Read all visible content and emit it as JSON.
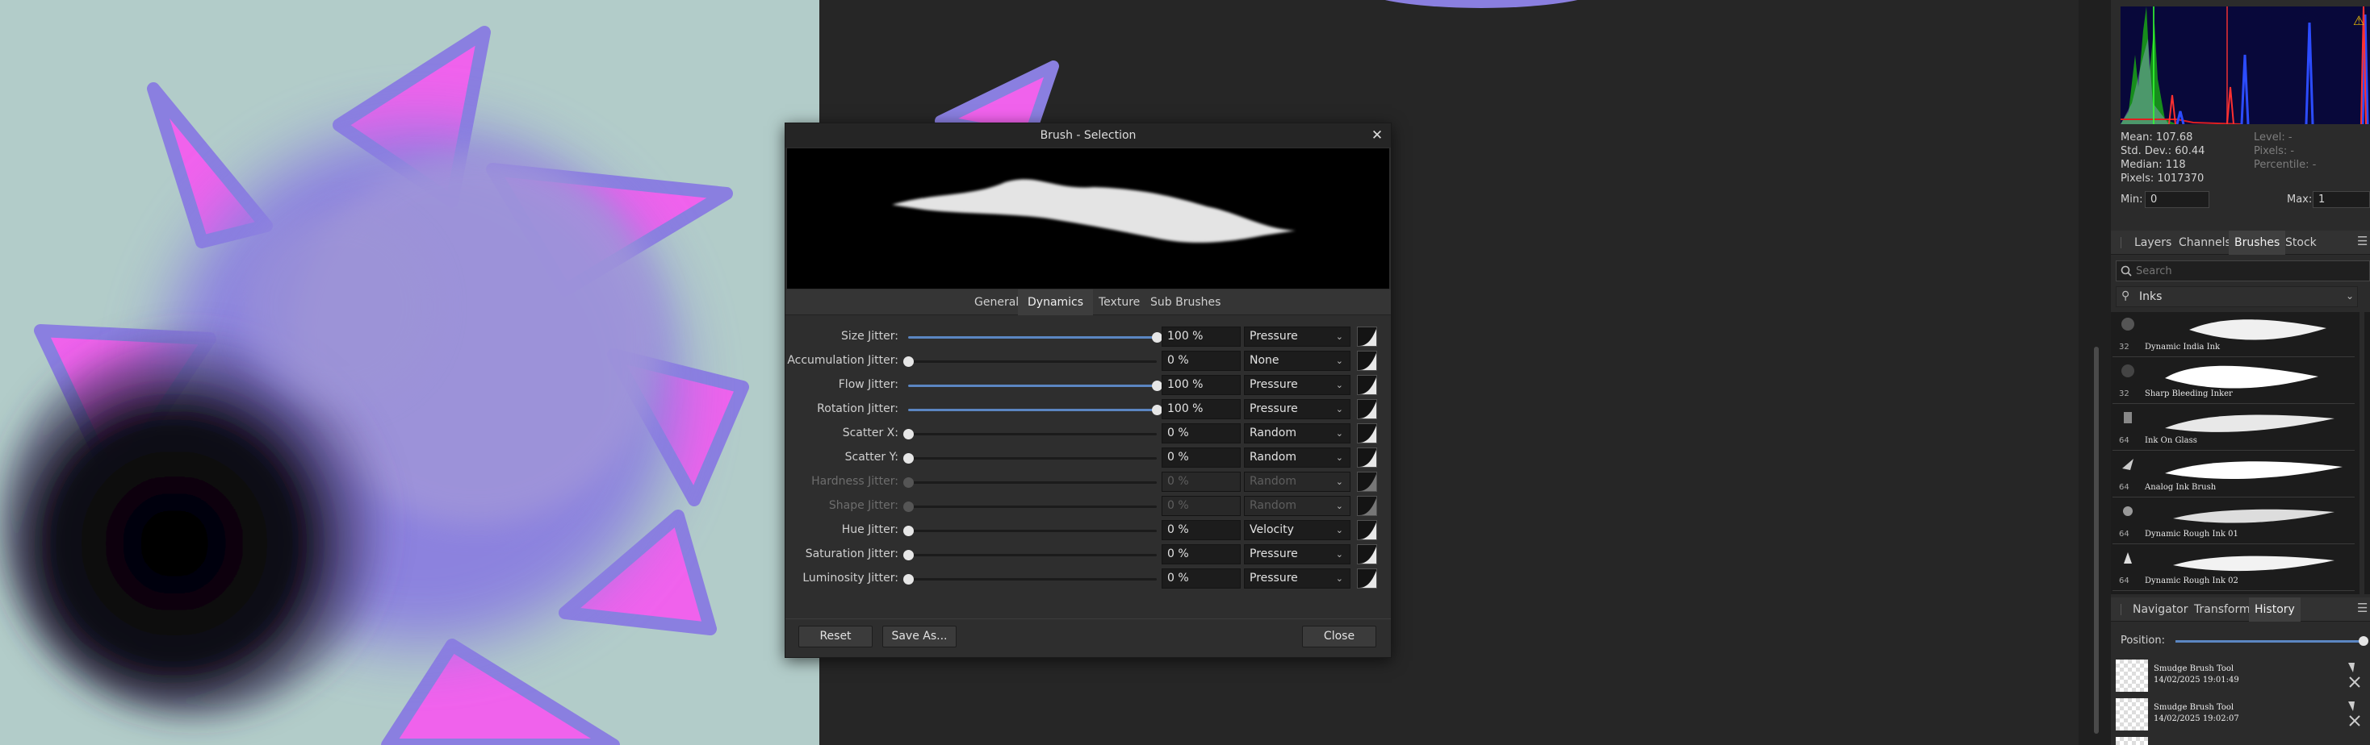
{
  "dialog": {
    "title": "Brush - Selection",
    "close_glyph": "✕",
    "tabs": [
      {
        "label": "General",
        "active": false
      },
      {
        "label": "Dynamics",
        "active": true
      },
      {
        "label": "Texture",
        "active": false
      },
      {
        "label": "Sub Brushes",
        "active": false
      }
    ],
    "rows": [
      {
        "label": "Size Jitter:",
        "value": "100 %",
        "level": 1.0,
        "controller": "Pressure",
        "enabled": true
      },
      {
        "label": "Accumulation Jitter:",
        "value": "0 %",
        "level": 0.0,
        "controller": "None",
        "enabled": true
      },
      {
        "label": "Flow Jitter:",
        "value": "100 %",
        "level": 1.0,
        "controller": "Pressure",
        "enabled": true
      },
      {
        "label": "Rotation Jitter:",
        "value": "100 %",
        "level": 1.0,
        "controller": "Pressure",
        "enabled": true
      },
      {
        "label": "Scatter X:",
        "value": "0 %",
        "level": 0.0,
        "controller": "Random",
        "enabled": true
      },
      {
        "label": "Scatter Y:",
        "value": "0 %",
        "level": 0.0,
        "controller": "Random",
        "enabled": true
      },
      {
        "label": "Hardness Jitter:",
        "value": "0 %",
        "level": 0.0,
        "controller": "Random",
        "enabled": false
      },
      {
        "label": "Shape Jitter:",
        "value": "0 %",
        "level": 0.0,
        "controller": "Random",
        "enabled": false
      },
      {
        "label": "Hue Jitter:",
        "value": "0 %",
        "level": 0.0,
        "controller": "Velocity",
        "enabled": true
      },
      {
        "label": "Saturation Jitter:",
        "value": "0 %",
        "level": 0.0,
        "controller": "Pressure",
        "enabled": true
      },
      {
        "label": "Luminosity Jitter:",
        "value": "0 %",
        "level": 0.0,
        "controller": "Pressure",
        "enabled": true
      }
    ],
    "buttons": {
      "reset": "Reset",
      "save_as": "Save As...",
      "close": "Close"
    }
  },
  "histogram": {
    "mean": "Mean: 107.68",
    "std_dev": "Std. Dev.: 60.44",
    "median": "Median: 118",
    "pixels": "Pixels: 1017370",
    "level": "Level: -",
    "pixels_right": "Pixels: -",
    "percentile": "Percentile: -",
    "min_label": "Min:",
    "min_value": "0",
    "max_label": "Max:",
    "max_value": "1",
    "warning_glyph": "⚠"
  },
  "panel_tabs": [
    {
      "label": "Layers",
      "active": false
    },
    {
      "label": "Channels",
      "active": false
    },
    {
      "label": "Brushes",
      "active": true
    },
    {
      "label": "Stock",
      "active": false
    }
  ],
  "brushes": {
    "search_placeholder": "Search",
    "category": "Inks",
    "items": [
      {
        "size": "32",
        "name": "Dynamic India Ink"
      },
      {
        "size": "32",
        "name": "Sharp Bleeding Inker"
      },
      {
        "size": "64",
        "name": "Ink On Glass"
      },
      {
        "size": "64",
        "name": "Analog Ink Brush"
      },
      {
        "size": "64",
        "name": "Dynamic Rough Ink 01"
      },
      {
        "size": "64",
        "name": "Dynamic Rough Ink 02"
      }
    ]
  },
  "bottom_tabs": [
    {
      "label": "Navigator",
      "active": false
    },
    {
      "label": "Transform",
      "active": false
    },
    {
      "label": "History",
      "active": true
    }
  ],
  "history": {
    "position_label": "Position:",
    "position_level": 1.0,
    "items": [
      {
        "name": "Smudge Brush Tool",
        "time": "14/02/2025 19:01:49"
      },
      {
        "name": "Smudge Brush Tool",
        "time": "14/02/2025 19:02:07"
      }
    ]
  },
  "colors": {
    "canvas_bg": "#b2ccc9",
    "petal_pink": "#f062ec",
    "petal_outline": "#8a7fe0",
    "slider_fill": "#5b86c2"
  },
  "icons": [
    "close-icon",
    "chevron-down-icon",
    "pressure-curve-icon",
    "search-icon",
    "brush-category-icon",
    "panel-menu-icon",
    "warning-icon"
  ]
}
